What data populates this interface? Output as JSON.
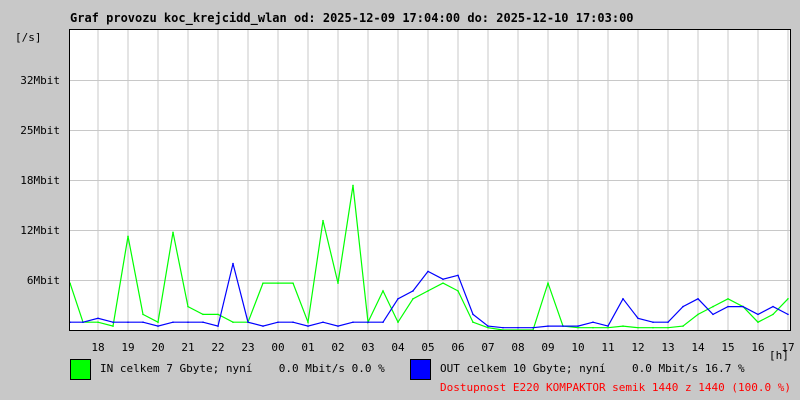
{
  "title": "Graf provozu koc_krejcidd_wlan od: 2025-12-09 17:04:00 do: 2025-12-10 17:03:00",
  "chart_data": {
    "type": "line",
    "ylabel": "[/s]",
    "xlabel": "[h]",
    "ylim": [
      0,
      38.4
    ],
    "y_ticks": [
      {
        "v": 6.4,
        "label": "6Mbit"
      },
      {
        "v": 12.8,
        "label": "12Mbit"
      },
      {
        "v": 19.2,
        "label": "18Mbit"
      },
      {
        "v": 25.6,
        "label": "25Mbit"
      },
      {
        "v": 32,
        "label": "32Mbit"
      }
    ],
    "x_ticks": [
      "18",
      "19",
      "20",
      "21",
      "22",
      "23",
      "00",
      "01",
      "02",
      "03",
      "04",
      "05",
      "06",
      "07",
      "08",
      "09",
      "10",
      "11",
      "12",
      "13",
      "14",
      "15",
      "16",
      "17"
    ],
    "grid": true,
    "x": [
      "17:04",
      "17:30",
      "18:00",
      "18:30",
      "19:00",
      "19:30",
      "20:00",
      "20:30",
      "21:00",
      "21:30",
      "22:00",
      "22:30",
      "23:00",
      "23:30",
      "00:00",
      "00:30",
      "01:00",
      "01:30",
      "02:00",
      "02:30",
      "03:00",
      "03:30",
      "04:00",
      "04:30",
      "05:00",
      "05:30",
      "06:00",
      "06:30",
      "07:00",
      "07:30",
      "08:00",
      "08:30",
      "09:00",
      "09:30",
      "10:00",
      "10:30",
      "11:00",
      "11:30",
      "12:00",
      "12:30",
      "13:00",
      "13:30",
      "14:00",
      "14:30",
      "15:00",
      "15:30",
      "16:00",
      "16:30",
      "17:00"
    ],
    "series": [
      {
        "name": "IN",
        "color": "#00ff00",
        "values": [
          6,
          1,
          1,
          0.5,
          12,
          2,
          1,
          12.5,
          3,
          2,
          2,
          1,
          1,
          6,
          6,
          6,
          1,
          14,
          6,
          18.5,
          1,
          5,
          1,
          4,
          5,
          6,
          5,
          1,
          0.3,
          0,
          0,
          0,
          6,
          0.5,
          0.3,
          0.3,
          0.3,
          0.5,
          0.3,
          0.3,
          0.3,
          0.5,
          2,
          3,
          4,
          3,
          1,
          2,
          4
        ]
      },
      {
        "name": "OUT",
        "color": "#0000ff",
        "values": [
          1,
          1,
          1.5,
          1,
          1,
          1,
          0.5,
          1,
          1,
          1,
          0.5,
          8.5,
          1,
          0.5,
          1,
          1,
          0.5,
          1,
          0.5,
          1,
          1,
          1,
          4,
          5,
          7.5,
          6.5,
          7,
          2,
          0.5,
          0.3,
          0.3,
          0.3,
          0.5,
          0.5,
          0.5,
          1,
          0.5,
          4,
          1.5,
          1,
          1,
          3,
          4,
          2,
          3,
          3,
          2,
          3,
          2
        ]
      }
    ]
  },
  "legend": {
    "in": "IN celkem 7 Gbyte; nyní    0.0 Mbit/s 0.0 %",
    "out": "OUT celkem 10 Gbyte; nyní    0.0 Mbit/s 16.7 %",
    "availability": "Dostupnost E220 KOMPAKTOR semik 1440 z 1440 (100.0 %)"
  }
}
